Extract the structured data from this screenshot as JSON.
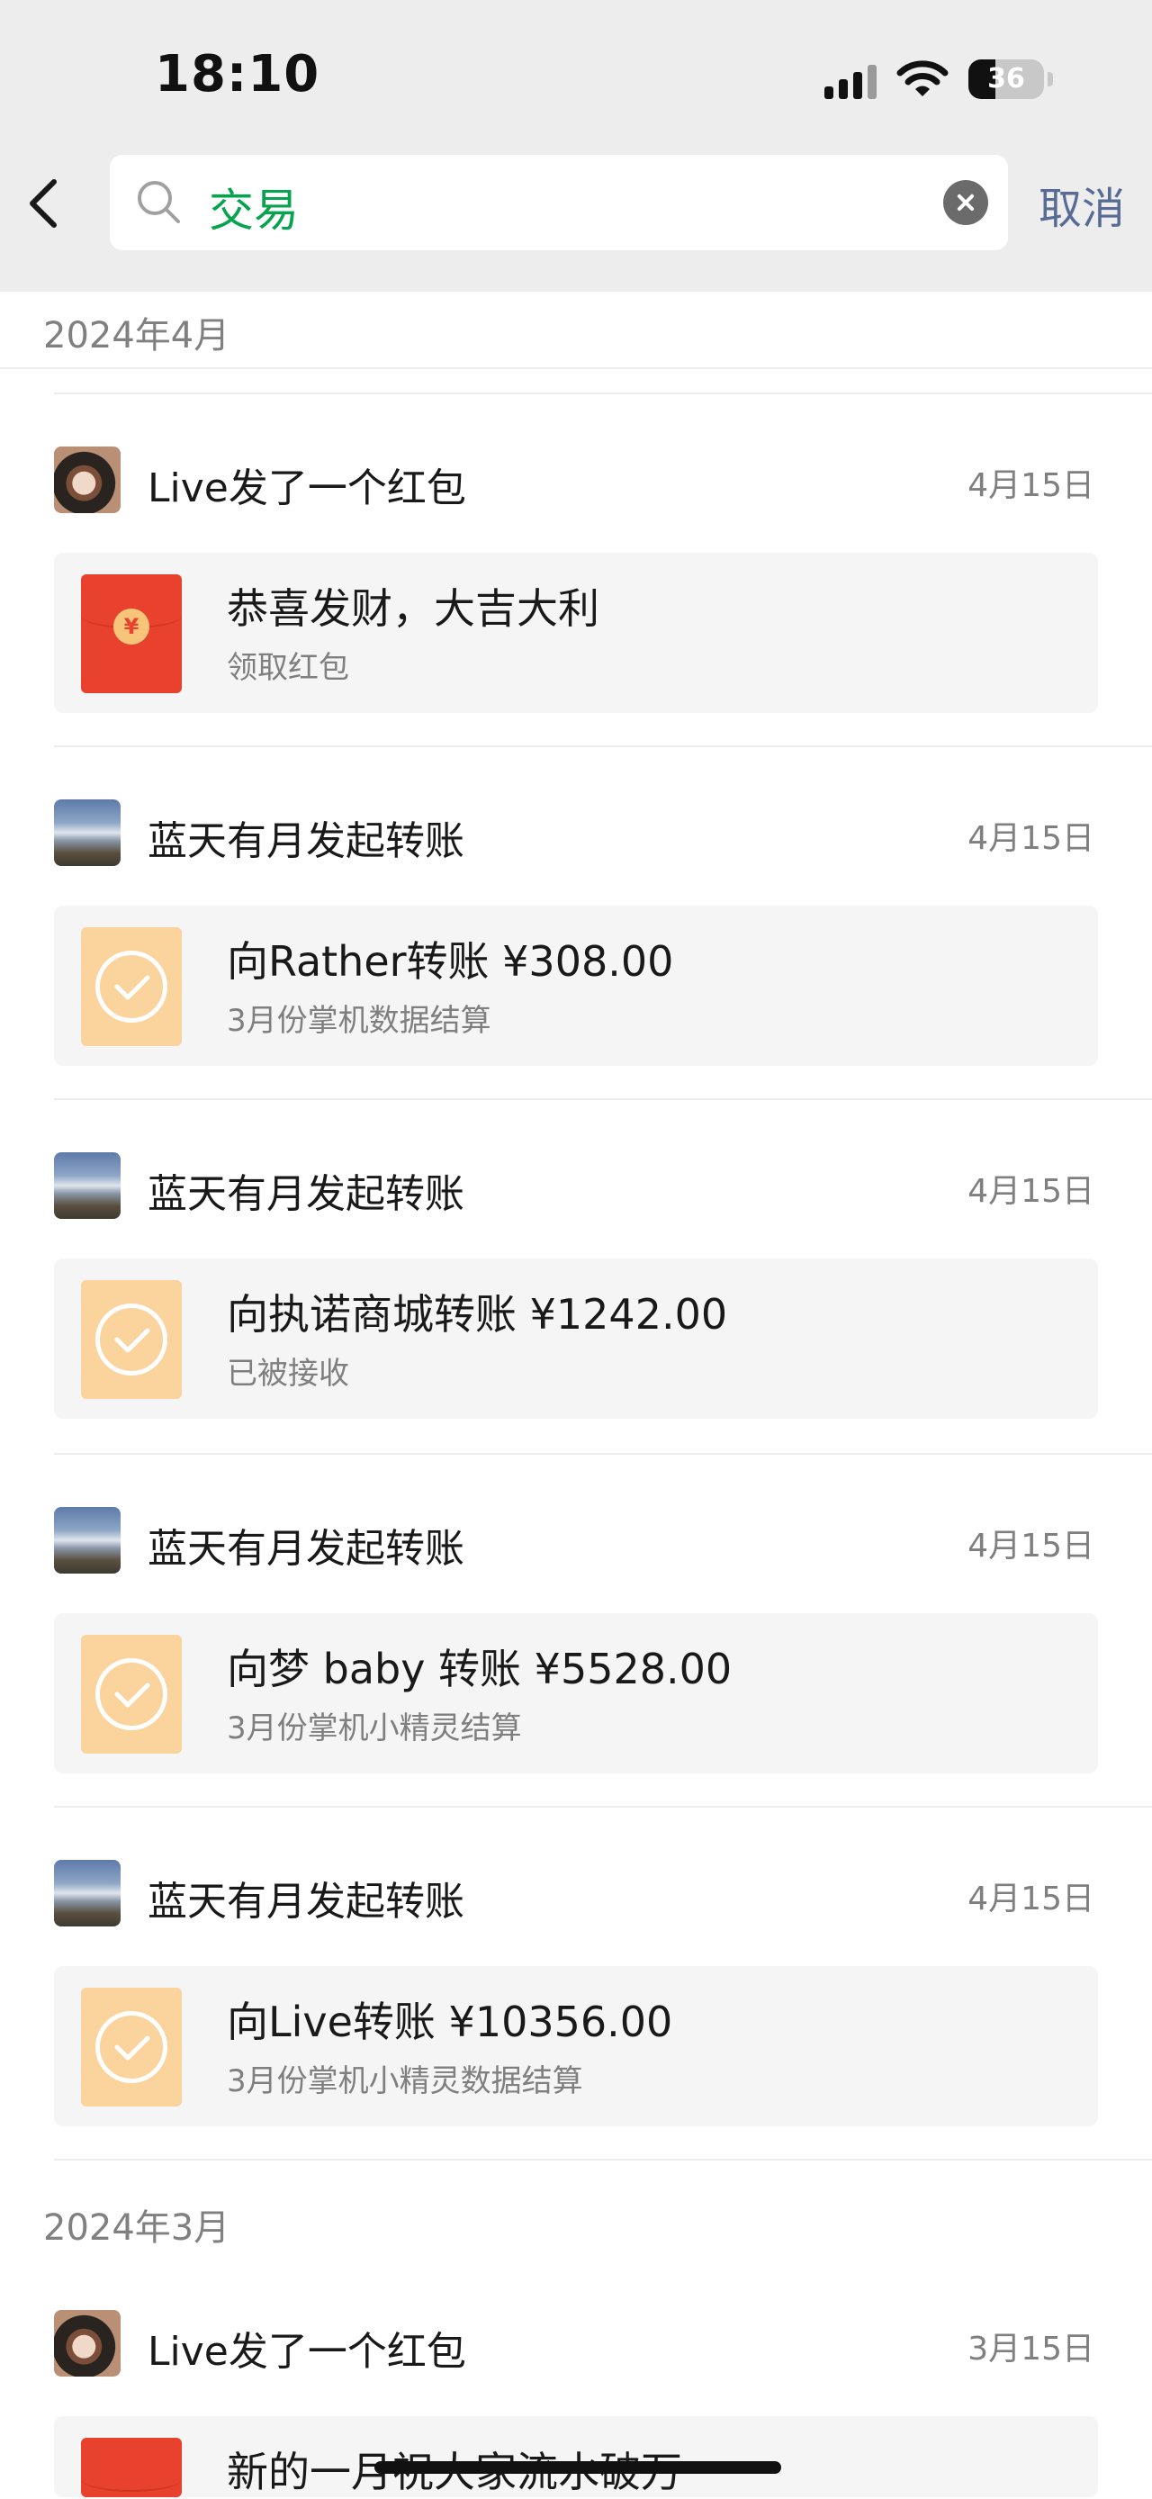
{
  "status_bar": {
    "time": "18:10",
    "battery": "36",
    "battery_level": 0.36
  },
  "search": {
    "query": "交易",
    "cancel_label": "取消"
  },
  "sections": [
    {
      "header": "2024年4月",
      "items": [
        {
          "avatar": "panda-avatar",
          "title": "Live发了一个红包",
          "date": "4月15日",
          "card_type": "red-packet",
          "card_title": "恭喜发财，大吉大利",
          "card_subtitle": "领取红包"
        },
        {
          "avatar": "sky-avatar",
          "title": "蓝天有月发起转账",
          "date": "4月15日",
          "card_type": "transfer",
          "card_title": "向Rather转账 ¥308.00",
          "card_subtitle": "3月份掌机数据结算"
        },
        {
          "avatar": "sky-avatar",
          "title": "蓝天有月发起转账",
          "date": "4月15日",
          "card_type": "transfer",
          "card_title": "向执诺商城转账 ¥1242.00",
          "card_subtitle": "已被接收"
        },
        {
          "avatar": "sky-avatar",
          "title": "蓝天有月发起转账",
          "date": "4月15日",
          "card_type": "transfer",
          "card_title": "向梦 baby 转账 ¥5528.00",
          "card_subtitle": "3月份掌机小精灵结算"
        },
        {
          "avatar": "sky-avatar",
          "title": "蓝天有月发起转账",
          "date": "4月15日",
          "card_type": "transfer",
          "card_title": "向Live转账 ¥10356.00",
          "card_subtitle": "3月份掌机小精灵数据结算"
        }
      ]
    },
    {
      "header": "2024年3月",
      "items": [
        {
          "avatar": "panda-avatar",
          "title": "Live发了一个红包",
          "date": "3月15日",
          "card_type": "red-packet",
          "card_title": "新的一月祝大家流水破万",
          "card_subtitle": ""
        }
      ]
    }
  ],
  "icons": {
    "red_packet_seal": "¥"
  }
}
